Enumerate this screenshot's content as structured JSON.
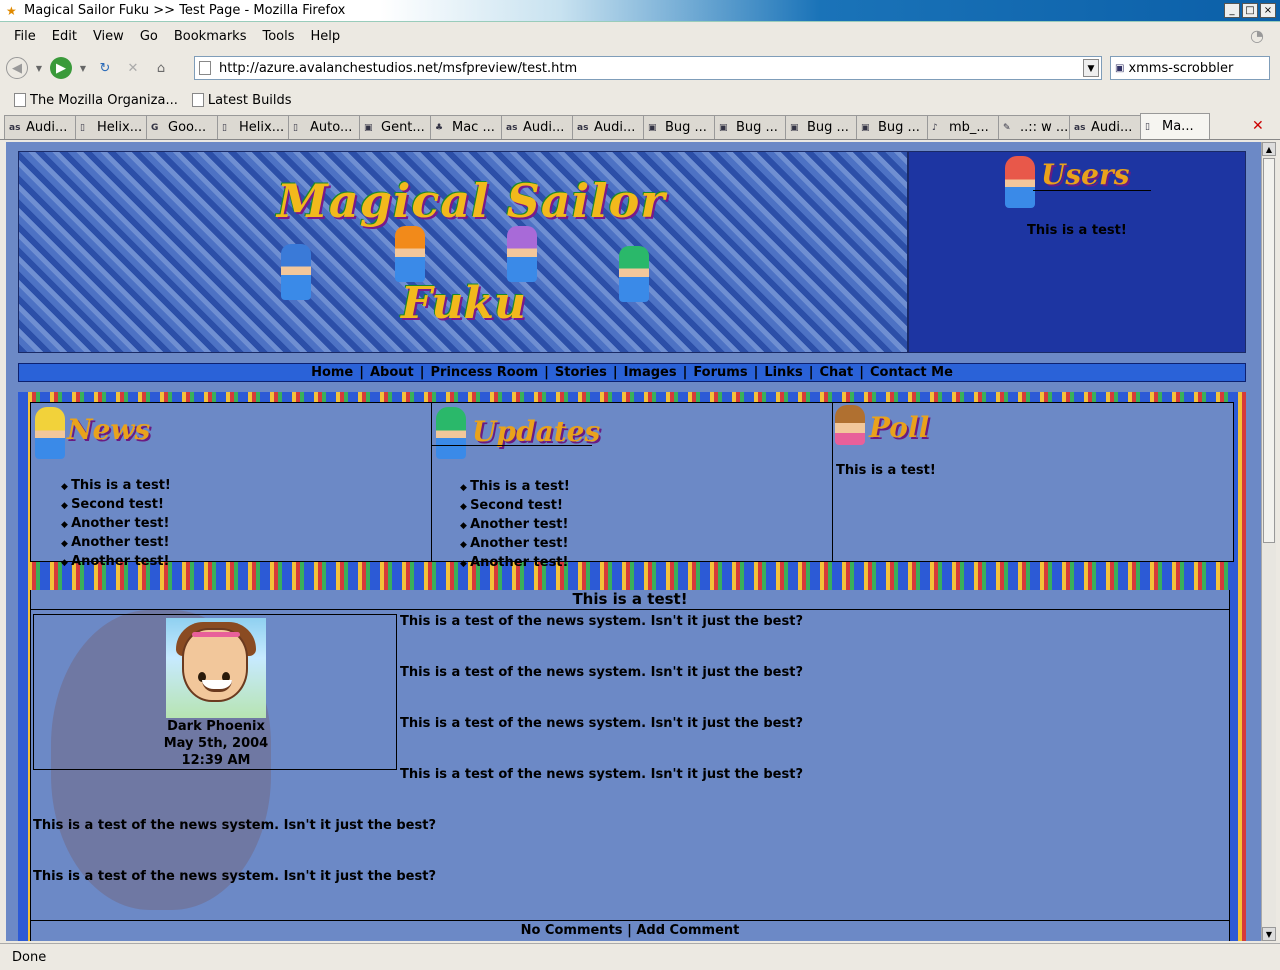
{
  "window": {
    "title": "Magical Sailor Fuku >> Test Page - Mozilla Firefox",
    "buttons": [
      "_",
      "□",
      "×"
    ]
  },
  "menu": [
    "File",
    "Edit",
    "View",
    "Go",
    "Bookmarks",
    "Tools",
    "Help"
  ],
  "toolbar": {
    "url": "http://azure.avalanchestudios.net/msfpreview/test.htm",
    "search_value": "xmms-scrobbler"
  },
  "bookmarks": [
    "The Mozilla Organiza...",
    "Latest Builds"
  ],
  "tabs": [
    {
      "label": "Audi...",
      "icon": "as"
    },
    {
      "label": "Helix...",
      "icon": "doc"
    },
    {
      "label": "Goo...",
      "icon": "G"
    },
    {
      "label": "Helix...",
      "icon": "doc"
    },
    {
      "label": "Auto...",
      "icon": "doc"
    },
    {
      "label": "Gent...",
      "icon": "bug"
    },
    {
      "label": "Mac ...",
      "icon": "leaf"
    },
    {
      "label": "Audi...",
      "icon": "as"
    },
    {
      "label": "Audi...",
      "icon": "as"
    },
    {
      "label": "Bug ...",
      "icon": "bug"
    },
    {
      "label": "Bug ...",
      "icon": "bug"
    },
    {
      "label": "Bug ...",
      "icon": "bug"
    },
    {
      "label": "Bug ...",
      "icon": "bug"
    },
    {
      "label": "mb_...",
      "icon": "music"
    },
    {
      "label": "..:: w ...",
      "icon": "pen"
    },
    {
      "label": "Audi...",
      "icon": "as"
    },
    {
      "label": "Ma...",
      "icon": "doc",
      "active": true
    }
  ],
  "status": "Done",
  "page": {
    "logo_line1": "Magical Sailor",
    "logo_line2": "Fuku",
    "users_title": "Users",
    "users_text": "This is a test!",
    "nav": [
      "Home",
      "About",
      "Princess Room",
      "Stories",
      "Images",
      "Forums",
      "Links",
      "Chat",
      "Contact Me"
    ],
    "news": {
      "title": "News",
      "items": [
        "This is a test!",
        "Second test!",
        "Another test!",
        "Another test!",
        "Another test!"
      ]
    },
    "updates": {
      "title": "Updates",
      "items": [
        "This is a test!",
        "Second test!",
        "Another test!",
        "Another test!",
        "Another test!"
      ]
    },
    "poll": {
      "title": "Poll",
      "text": "This is a test!"
    },
    "article": {
      "title": "This is a test!",
      "author": "Dark Phoenix",
      "date": "May 5th, 2004",
      "time": "12:39 AM",
      "paragraphs": [
        "This is a test of the news system. Isn't it just the best?",
        "This is a test of the news system. Isn't it just the best?",
        "This is a test of the news system. Isn't it just the best?",
        "This is a test of the news system. Isn't it just the best?",
        "This is a test of the news system. Isn't it just the best?",
        "This is a test of the news system. Isn't it just the best?"
      ],
      "footer": {
        "comments": "No Comments",
        "separator": "|",
        "add": "Add Comment"
      }
    }
  },
  "colors": {
    "page_bg": "#6c89c6",
    "nav_bg": "#2a62d8",
    "users_bg": "#1d35a2",
    "logo_text": "#f2b91c"
  }
}
